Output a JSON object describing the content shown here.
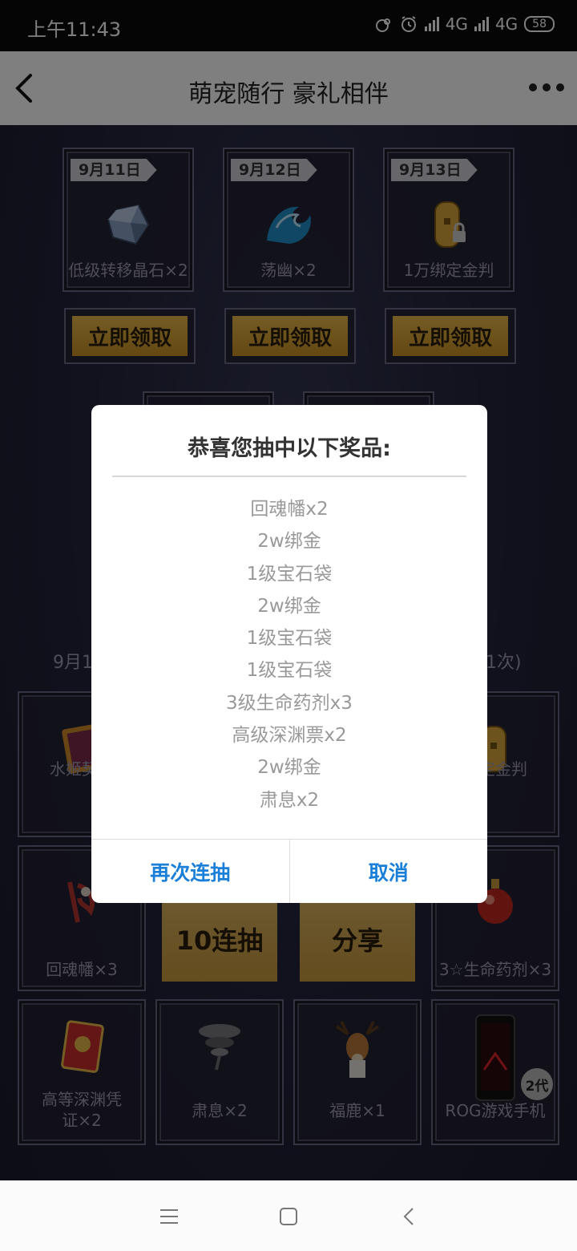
{
  "status_bar": {
    "time": "上午11:43",
    "network_1": "4G",
    "network_2": "4G",
    "battery": "58"
  },
  "title_bar": {
    "title": "萌宠随行 豪礼相伴"
  },
  "daily_rewards": [
    {
      "date": "9月11日",
      "label": "低级转移晶石×2",
      "icon": "crystal-icon"
    },
    {
      "date": "9月12日",
      "label": "荡幽×2",
      "icon": "wave-icon"
    },
    {
      "date": "9月13日",
      "label": "1万绑定金判",
      "icon": "gold-token-icon"
    }
  ],
  "claim_buttons": [
    "立即领取",
    "立即领取",
    "立即领取"
  ],
  "background_text": {
    "left_fragment": "9月1",
    "right_fragment": "1次)"
  },
  "prize_grid": {
    "row1": [
      {
        "label": "水姬契约",
        "icon": "card-icon"
      },
      {
        "label": "绑定金判",
        "icon": "gold-token-icon"
      }
    ],
    "row2": [
      {
        "label": "回魂幡×3",
        "icon": "banner-icon"
      },
      {
        "label": "3☆生命药剂×3",
        "icon": "potion-icon"
      }
    ],
    "row3": [
      {
        "label": "高等深渊凭证×2",
        "icon": "ticket-icon"
      },
      {
        "label": "肃息×2",
        "icon": "tornado-icon"
      },
      {
        "label": "福鹿×1",
        "icon": "deer-icon"
      },
      {
        "label": "ROG游戏手机",
        "icon": "phone-icon",
        "badge": "2代"
      }
    ]
  },
  "action_buttons": {
    "draw_ten": "10连抽",
    "share": "分享"
  },
  "dialog": {
    "title": "恭喜您抽中以下奖品:",
    "prizes": [
      "回魂幡x2",
      "2w绑金",
      "1级宝石袋",
      "2w绑金",
      "1级宝石袋",
      "1级宝石袋",
      "3级生命药剂x3",
      "高级深渊票x2",
      "2w绑金",
      "肃息x2"
    ],
    "draw_again": "再次连抽",
    "cancel": "取消"
  },
  "colors": {
    "accent_blue": "#1a7fd8",
    "gold": "#d9a43a",
    "background": "#22233a"
  }
}
